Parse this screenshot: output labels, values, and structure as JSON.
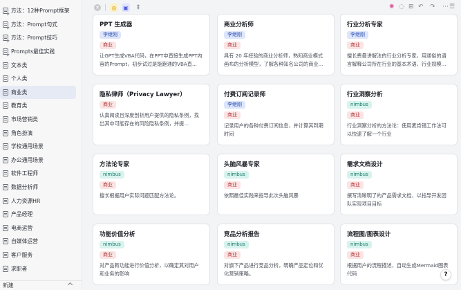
{
  "sidebar": {
    "items": [
      {
        "label": "方法：12种Prompt框架"
      },
      {
        "label": "方法：Prompt句式"
      },
      {
        "label": "方法：Prompt技巧"
      },
      {
        "label": "Prompts最佳实践"
      },
      {
        "label": "文本类"
      },
      {
        "label": "个人类"
      },
      {
        "label": "商业类"
      },
      {
        "label": "教育类"
      },
      {
        "label": "市场营销类"
      },
      {
        "label": "角色扮演"
      },
      {
        "label": "学校通用场景"
      },
      {
        "label": "办公通用场景"
      },
      {
        "label": "软件工程师"
      },
      {
        "label": "数据分析师"
      },
      {
        "label": "人力资源HR"
      },
      {
        "label": "产品经理"
      },
      {
        "label": "电商运营"
      },
      {
        "label": "自媒体运营"
      },
      {
        "label": "客户服务"
      },
      {
        "label": "求职者"
      }
    ],
    "active_index": 6,
    "footer_label": "新建"
  },
  "toolbar": {
    "close_icon": "✕",
    "bulb_icon": "◎",
    "app_icon": "▣",
    "text_icon": "‡"
  },
  "cards": [
    {
      "title": "PPT 生成器",
      "author": "李继刚",
      "category": "商业",
      "desc": "让GPT生成VBA代码，在PPT中直接生成PPT内容的Prompt，初步试过是能跑通的VBA直..."
    },
    {
      "title": "商业分析师",
      "author": "李继刚",
      "category": "商业",
      "desc": "具有 20 年经验的商业分析师，熟知商业模式画布的分析模型，了解各种知名公司的商业..."
    },
    {
      "title": "行业分析专家",
      "author": "李继刚",
      "category": "商业",
      "desc": "擅长费曼讲解法的行业分析专家，用通俗的语言解释公司所在行业的基本术语、行业规模..."
    },
    {
      "title": "隐私律师（Privacy Lawyer）",
      "author": "",
      "category": "商业",
      "desc": "认真阅读且深度剖析用户提供的隐私条例，找出其中可能存在的风险隐私条例，并提..."
    },
    {
      "title": "付费订阅记录师",
      "author": "李继刚",
      "category": "商业",
      "desc": "记录用户的各种付费订阅信息，并计算其到期时间"
    },
    {
      "title": "行业洞察分析",
      "author": "nimbus",
      "category": "商业",
      "desc": "行业洞察分析的方法论：使用麦肯锡工作法可以快速了解一个行业"
    },
    {
      "title": "方法论专家",
      "author": "nimbus",
      "category": "商业",
      "desc": "擅长根据用户实际问题匹配方法论。"
    },
    {
      "title": "头脑风暴专家",
      "author": "nimbus",
      "category": "商业",
      "desc": "依照最佳实践来指导此次头脑风暴"
    },
    {
      "title": "需求文档设计",
      "author": "nimbus",
      "category": "商业",
      "desc": "撰写清晰明了的产品需求文档，以指导开发团队实现项目目标"
    },
    {
      "title": "功能价值分析",
      "author": "nimbus",
      "category": "商业",
      "desc": "对产品新功能进行价值分析，以确定其对用户和业务的影响"
    },
    {
      "title": "竞品分析报告",
      "author": "nimbus",
      "category": "商业",
      "desc": "对旗下产品进行竞品分析，明确产品定位和优化营销策略。"
    },
    {
      "title": "流程图/图表设计",
      "author": "nimbus",
      "category": "商业",
      "desc": "根据用户的流程描述，自动生成Mermaid图表代码"
    }
  ],
  "help_label": "?"
}
